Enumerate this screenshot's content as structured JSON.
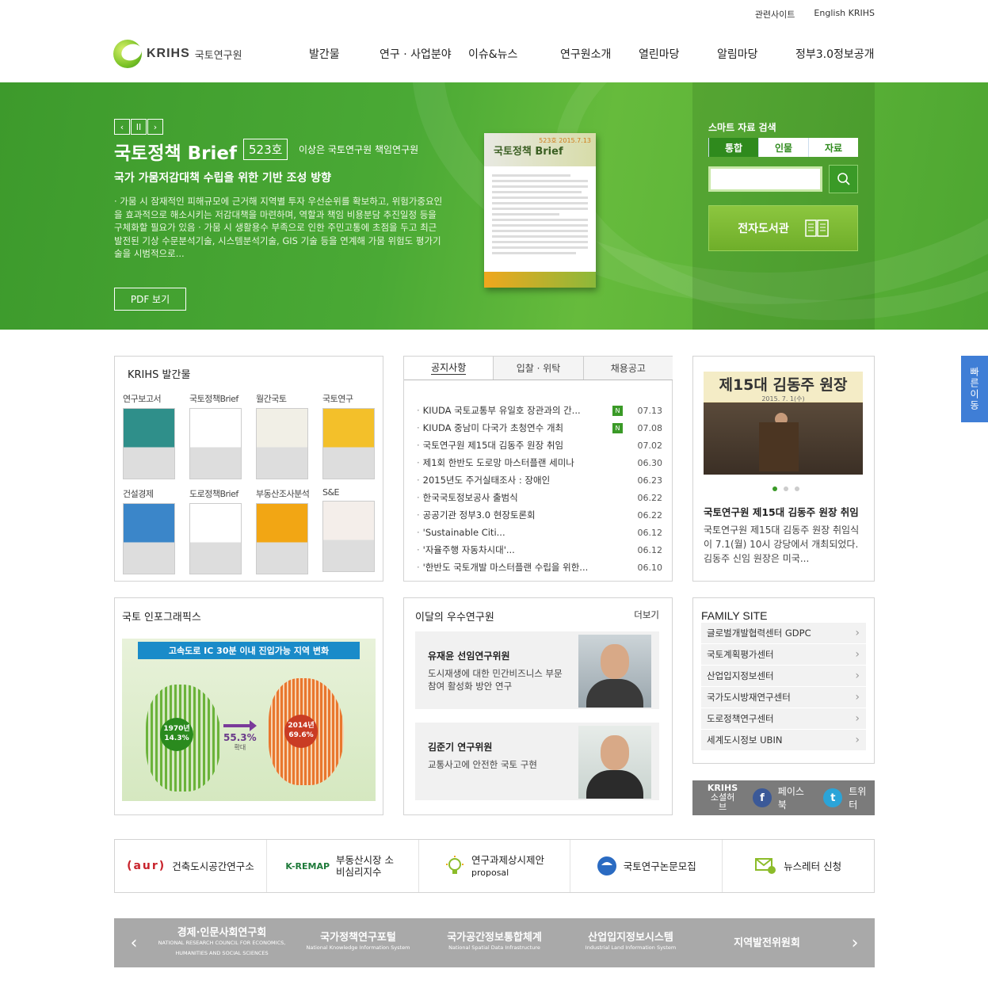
{
  "util": {
    "related": "관련사이트",
    "english": "English KRIHS"
  },
  "logo": {
    "en": "KRIHS",
    "ko": "국토연구원"
  },
  "gnb": [
    "발간물",
    "연구 · 사업분야",
    "이슈&뉴스",
    "연구원소개",
    "열린마당",
    "알림마당",
    "정부3.0정보공개"
  ],
  "hero": {
    "controls": [
      "‹",
      "II",
      "›"
    ],
    "title": "국토정책 Brief",
    "issue": "523호",
    "author": "이상은 국토연구원 책임연구원",
    "subtitle": "국가 가뭄저감대책 수립을 위한 기반 조성 방향",
    "desc": "· 가뭄 시 잠재적인 피해규모에 근거해 지역별 투자 우선순위를 확보하고, 위험가중요인을 효과적으로 해소시키는 저감대책을 마련하며, 역할과 책임 비용분담 추진일정 등을 구체화할 필요가 있음 · 가뭄 시 생활용수 부족으로 인한 주민고통에 초점을 두고 최근 발전된 기상 수문분석기술, 시스템분석기술, GIS 기술 등을 연계해 가뭄 위험도 평가기술을 시범적으로...",
    "pdf_label": "PDF 보기",
    "book_title": "국토정책 Brief",
    "book_no": "523호 2015.7.13"
  },
  "search": {
    "label": "스마트 자료 검색",
    "tabs": [
      "통합",
      "인물",
      "자료"
    ],
    "active_tab": 0,
    "input_value": "",
    "library": "전자도서관"
  },
  "pubs": {
    "title": "KRIHS 발간물",
    "items": [
      {
        "label": "연구보고서",
        "color": "#2f8f8a"
      },
      {
        "label": "국토정책Brief",
        "color": "#ffffff"
      },
      {
        "label": "월간국토",
        "color": "#f1efe6"
      },
      {
        "label": "국토연구",
        "color": "#f3c02a"
      },
      {
        "label": "건설경제",
        "color": "#3b86c9"
      },
      {
        "label": "도로정책Brief",
        "color": "#ffffff"
      },
      {
        "label": "부동산조사분석",
        "color": "#f2a614"
      },
      {
        "label": "S&E",
        "color": "#f4eeea"
      }
    ]
  },
  "notice": {
    "tabs": [
      "공지사항",
      "입찰 · 위탁",
      "채용공고"
    ],
    "new_badge": "N",
    "rows": [
      {
        "text": "KIUDA 국토교통부 유일호 장관과의 간...",
        "date": "07.13",
        "new": true
      },
      {
        "text": "KIUDA 중남미 다국가 초청연수 개최",
        "date": "07.08",
        "new": true
      },
      {
        "text": "국토연구원 제15대 김동주 원장 취임",
        "date": "07.02",
        "new": false
      },
      {
        "text": "제1회 한반도 도로망 마스터플랜 세미나",
        "date": "06.30",
        "new": false
      },
      {
        "text": "2015년도 주거실태조사 : 장애인",
        "date": "06.23",
        "new": false
      },
      {
        "text": "한국국토정보공사 출범식",
        "date": "06.22",
        "new": false
      },
      {
        "text": "공공기관 정부3.0 현장토론회",
        "date": "06.22",
        "new": false
      },
      {
        "text": "'Sustainable Citi...",
        "date": "06.12",
        "new": false
      },
      {
        "text": "'자율주행 자동차시대'...",
        "date": "06.12",
        "new": false
      },
      {
        "text": "'한반도 국토개발 마스터플랜 수립을 위한...",
        "date": "06.10",
        "new": false
      }
    ]
  },
  "news": {
    "banner": "제15대 김동주 원장",
    "banner_date": "2015. 7. 1(수)",
    "title": "국토연구원 제15대 김동주 원장 취임",
    "desc": "국토연구원 제15대 김동주 원장 취임식이 7.1(월) 10시 강당에서 개최되었다. 김동주 신임 원장은 미국...",
    "slides": 3,
    "active_slide": 0
  },
  "info": {
    "title": "국토 인포그래픽스",
    "banner": "고속도로 IC 30분 이내 진입가능 지역 변화",
    "y1970_label": "1970년",
    "y1970": "14.3%",
    "y2014_label": "2014년",
    "y2014": "69.6%",
    "change": "55.3%",
    "change_label": "확대"
  },
  "researchers": {
    "title": "이달의 우수연구원",
    "more": "더보기",
    "items": [
      {
        "name": "유재윤 선임연구위원",
        "desc": "도시재생에 대한 민간비즈니스 부문 참여 활성화 방안 연구"
      },
      {
        "name": "김준기 연구위원",
        "desc": "교통사고에 안전한 국토 구현"
      }
    ]
  },
  "family": {
    "title": "FAMILY SITE",
    "items": [
      "글로벌개발협력센터 GDPC",
      "국토계획평가센터",
      "산업입지정보센터",
      "국가도시방재연구센터",
      "도로정책연구센터",
      "세계도시정보 UBIN"
    ]
  },
  "social": {
    "hub1": "KRIHS",
    "hub2": "소셜허브",
    "facebook": "페이스북",
    "twitter": "트위터"
  },
  "banners": [
    {
      "logo": "(aur)",
      "label": "건축도시공간연구소"
    },
    {
      "logo": "K-REMAP",
      "label": "부동산시장 소비심리지수"
    },
    {
      "logo": "bulb",
      "label": "연구과제상시제안",
      "sub": "proposal"
    },
    {
      "logo": "taeguk",
      "label": "국토연구논문모집"
    },
    {
      "logo": "mail",
      "label": "뉴스레터 신청"
    }
  ],
  "partners": [
    {
      "name": "경제·인문사회연구회",
      "sub": "NATIONAL RESEARCH COUNCIL FOR ECONOMICS, HUMANITIES AND SOCIAL SCIENCES"
    },
    {
      "name": "국가정책연구포털",
      "sub": "National Knowledge Information System"
    },
    {
      "name": "국가공간정보통합체계",
      "sub": "National Spatial Data Infrastructure"
    },
    {
      "name": "산업입지정보시스템",
      "sub": "Industrial Land Information System"
    },
    {
      "name": "지역발전위원회",
      "sub": ""
    }
  ],
  "partner_prev": "‹",
  "partner_next": "›",
  "quick": "빠른이동"
}
